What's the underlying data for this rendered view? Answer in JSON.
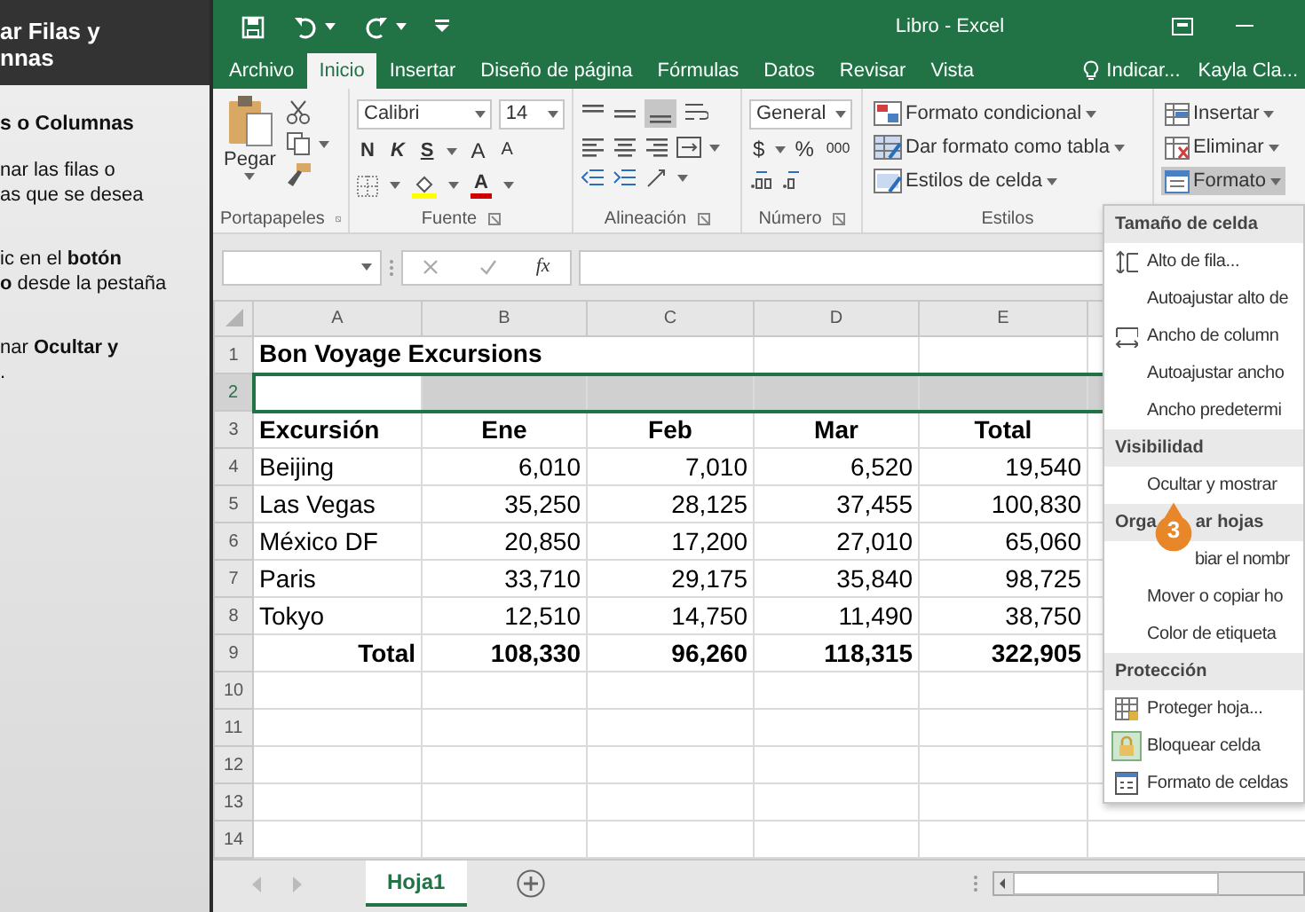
{
  "tutorial": {
    "title_lines": [
      "ar Filas y",
      "nnas"
    ],
    "heading": "s o Columnas",
    "steps": [
      {
        "lines": [
          "nar las filas o",
          "as que se desea"
        ]
      },
      {
        "lines": [
          "ic en el **botón**",
          "**o** desde la pestaña"
        ]
      },
      {
        "lines": [
          "nar **Ocultar y**",
          "."
        ]
      }
    ]
  },
  "window": {
    "title": "Libro - Excel"
  },
  "ribbon_tabs": [
    {
      "label": "Archivo",
      "selected": false
    },
    {
      "label": "Inicio",
      "selected": true
    },
    {
      "label": "Insertar",
      "selected": false
    },
    {
      "label": "Diseño de página",
      "selected": false
    },
    {
      "label": "Fórmulas",
      "selected": false
    },
    {
      "label": "Datos",
      "selected": false
    },
    {
      "label": "Revisar",
      "selected": false
    },
    {
      "label": "Vista",
      "selected": false
    }
  ],
  "tell_me": "Indicar...",
  "user": "Kayla Cla...",
  "ribbon": {
    "clipboard": {
      "paste": "Pegar",
      "label": "Portapapeles"
    },
    "font": {
      "name": "Calibri",
      "size": "14",
      "bold": "N",
      "italic": "K",
      "underline": "S",
      "grow": "A",
      "shrink": "A",
      "color_button": "A",
      "label": "Fuente"
    },
    "alignment": {
      "label": "Alineación"
    },
    "number": {
      "format": "General",
      "currency": "$",
      "percent": "%",
      "thousands": "000",
      "label": "Número"
    },
    "styles": {
      "items": [
        "Formato condicional",
        "Dar formato como tabla",
        "Estilos de celda"
      ],
      "label": "Estilos"
    },
    "cells": {
      "items": [
        {
          "label": "Insertar",
          "kind": "insert",
          "selected": false
        },
        {
          "label": "Eliminar",
          "kind": "delete",
          "selected": false
        },
        {
          "label": "Formato",
          "kind": "format",
          "selected": true
        }
      ]
    }
  },
  "formula_bar": {
    "function_label": "fx"
  },
  "sheet": {
    "columns": [
      "A",
      "B",
      "C",
      "D",
      "E"
    ],
    "rows": [
      {
        "number": "1",
        "kind": "title",
        "selected": false,
        "cells": [
          "Bon Voyage Excursions"
        ]
      },
      {
        "number": "2",
        "kind": "blank",
        "selected": true
      },
      {
        "number": "3",
        "kind": "header",
        "selected": false,
        "cells": [
          "Excursión",
          "Ene",
          "Feb",
          "Mar",
          "Total"
        ]
      },
      {
        "number": "4",
        "kind": "data",
        "selected": false,
        "cells": [
          "Beijing",
          "6,010",
          "7,010",
          "6,520",
          "19,540"
        ]
      },
      {
        "number": "5",
        "kind": "data",
        "selected": false,
        "cells": [
          "Las Vegas",
          "35,250",
          "28,125",
          "37,455",
          "100,830"
        ]
      },
      {
        "number": "6",
        "kind": "data",
        "selected": false,
        "cells": [
          "México DF",
          "20,850",
          "17,200",
          "27,010",
          "65,060"
        ]
      },
      {
        "number": "7",
        "kind": "data",
        "selected": false,
        "cells": [
          "Paris",
          "33,710",
          "29,175",
          "35,840",
          "98,725"
        ]
      },
      {
        "number": "8",
        "kind": "data",
        "selected": false,
        "cells": [
          "Tokyo",
          "12,510",
          "14,750",
          "11,490",
          "38,750"
        ]
      },
      {
        "number": "9",
        "kind": "total",
        "selected": false,
        "cells": [
          "Total",
          "108,330",
          "96,260",
          "118,315",
          "322,905"
        ]
      },
      {
        "number": "10",
        "kind": "blank",
        "selected": false
      },
      {
        "number": "11",
        "kind": "blank",
        "selected": false
      },
      {
        "number": "12",
        "kind": "blank",
        "selected": false
      },
      {
        "number": "13",
        "kind": "blank",
        "selected": false
      },
      {
        "number": "14",
        "kind": "blank",
        "selected": false
      }
    ]
  },
  "sheet_tabs": [
    {
      "label": "Hoja1",
      "selected": true
    }
  ],
  "format_menu": {
    "sections": [
      {
        "header": "Tamaño de celda",
        "items": [
          {
            "label": "Alto de fila...",
            "kind": "rowheight",
            "checked": false
          },
          {
            "label": "Autoajustar alto de",
            "kind": "plain",
            "checked": false
          },
          {
            "label": "Ancho de column",
            "kind": "colwidth",
            "checked": false
          },
          {
            "label": "Autoajustar ancho",
            "kind": "plain",
            "checked": false
          },
          {
            "label": "Ancho predetermi",
            "kind": "plain",
            "checked": false
          }
        ]
      },
      {
        "header": "Visibilidad",
        "items": [
          {
            "label": "Ocultar y mostrar",
            "kind": "plain",
            "checked": false
          }
        ]
      },
      {
        "header_parts": [
          "Orga",
          "ar hojas"
        ],
        "items": [
          {
            "label": "biar el nombr",
            "kind": "covered",
            "checked": false
          },
          {
            "label": "Mover o copiar ho",
            "kind": "plain",
            "checked": false
          },
          {
            "label": "Color de etiqueta",
            "kind": "plain",
            "checked": false
          }
        ]
      },
      {
        "header": "Protección",
        "items": [
          {
            "label": "Proteger hoja...",
            "kind": "protect",
            "checked": false
          },
          {
            "label": "Bloquear celda",
            "kind": "lock",
            "checked": true
          },
          {
            "label": "Formato de celdas",
            "kind": "formatcells",
            "checked": false
          }
        ]
      }
    ]
  },
  "callout": "3"
}
